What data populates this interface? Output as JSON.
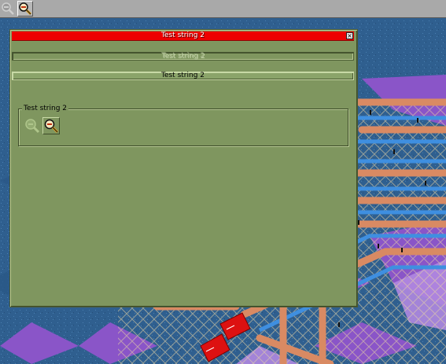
{
  "toolbar": {
    "buttons": [
      {
        "icon": "zoom-out-icon",
        "enabled": false
      },
      {
        "icon": "zoom-in-icon",
        "enabled": true
      }
    ]
  },
  "window": {
    "title": "Test string 2",
    "close_label": "×",
    "disabled_row_label": "Test string 2",
    "enabled_row_label": "Test string 2",
    "group": {
      "label": "Test string 2",
      "buttons": [
        {
          "icon": "zoom-out-icon",
          "enabled": false
        },
        {
          "icon": "zoom-in-icon",
          "enabled": true
        }
      ]
    }
  },
  "colors": {
    "window_bg": "#7f965f",
    "titlebar": "#ee0000",
    "water": "#2f5f8f",
    "track": "#d98a63",
    "support": "#3f8fe0",
    "path": "#8a55c8",
    "train": "#dd1111"
  }
}
